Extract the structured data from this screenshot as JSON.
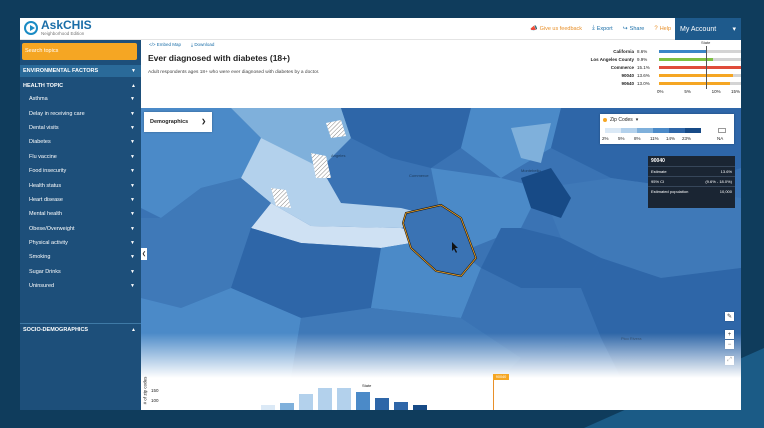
{
  "app": {
    "name": "AskCHIS",
    "subtitle": "Neighborhood Edition"
  },
  "header": {
    "links": [
      {
        "label": "Give us feedback",
        "icon": "megaphone-icon"
      },
      {
        "label": "Export",
        "icon": "download-icon"
      },
      {
        "label": "Share",
        "icon": "share-icon"
      },
      {
        "label": "Help",
        "icon": "help-icon"
      }
    ],
    "account": "My Account"
  },
  "sidebar": {
    "search_placeholder": "Search topics",
    "environmental": "ENVIRONMENTAL FACTORS",
    "health_topic": "HEALTH TOPIC",
    "items": [
      "Asthma",
      "Delay in receiving care",
      "Dental visits",
      "Diabetes",
      "Flu vaccine",
      "Food insecurity",
      "Health status",
      "Heart disease",
      "Mental health",
      "Obese/Overweight",
      "Physical activity",
      "Smoking",
      "Sugar Drinks",
      "Uninsured"
    ],
    "socio": "SOCIO-DEMOGRAPHICS"
  },
  "main": {
    "embed": "Embed Map",
    "download": "Download",
    "title": "Ever diagnosed with diabetes (18+)",
    "subtitle": "Adult respondents ages 18+ who were ever diagnosed with diabetes by a doctor."
  },
  "chart_data": {
    "type": "bar",
    "categories": [
      "California",
      "Los Angeles County",
      "Commerce",
      "90040",
      "90640"
    ],
    "values": [
      8.6,
      9.9,
      15.1,
      13.6,
      13.0
    ],
    "value_labels": [
      "8.6%",
      "9.9%",
      "15.1%",
      "13.6%",
      "13.0%"
    ],
    "colors": [
      "#3b86c6",
      "#7dc142",
      "#e04b3a",
      "#f5a623",
      "#f5a623"
    ],
    "reference": {
      "label": "State",
      "value": 8.6
    },
    "xlim": [
      0,
      15
    ],
    "xticks": [
      "0%",
      "5%",
      "10%",
      "15%"
    ]
  },
  "map": {
    "demographics_label": "Demographics",
    "legend": {
      "title": "Zip Codes",
      "colors": [
        "#dbe9f6",
        "#b3d1ec",
        "#7fb0db",
        "#4b8ac8",
        "#2e66a8",
        "#174a86"
      ],
      "ticks": [
        "2%",
        "5%",
        "8%",
        "11%",
        "14%",
        "23%"
      ],
      "na": "NA"
    },
    "tooltip": {
      "zip": "90040",
      "rows": [
        {
          "label": "Estimate",
          "value": "13.6%"
        },
        {
          "label": "95% CI",
          "value": "(9.6% - 18.0%)"
        },
        {
          "label": "Estimated population",
          "value": "10,000"
        }
      ]
    },
    "labels": [
      "Angeles",
      "Commerce",
      "Pico Rivera",
      "Montebello"
    ]
  },
  "histogram": {
    "ylabel": "# of zip codes",
    "yticks": [
      "150",
      "100"
    ],
    "state_label": "State",
    "zip_flag": "90040",
    "bars": [
      10,
      16,
      34,
      48,
      47,
      40,
      27,
      18,
      12
    ],
    "bar_colors": [
      "#dbe9f6",
      "#7fb0db",
      "#b3d1ec",
      "#b3d1ec",
      "#b3d1ec",
      "#4b8ac8",
      "#2e66a8",
      "#2e66a8",
      "#174a86"
    ]
  }
}
